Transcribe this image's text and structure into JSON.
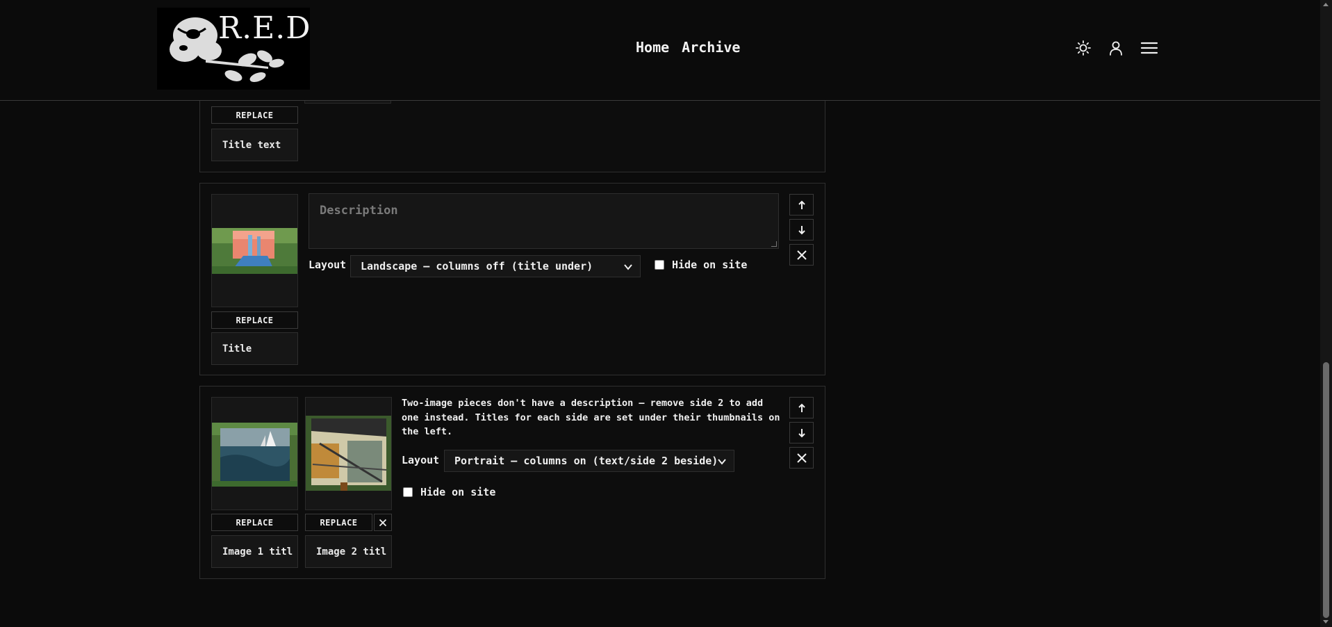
{
  "header": {
    "logo_text": "R.E.D",
    "nav": {
      "home": "Home",
      "archive": "Archive"
    },
    "icons": [
      "sun-icon",
      "user-icon",
      "menu-icon"
    ]
  },
  "card1": {
    "replace_label": "REPLACE",
    "title_value": "Title text"
  },
  "card2": {
    "description_placeholder": "Description",
    "layout_label": "Layout",
    "layout_value": "Landscape — columns off (title under)",
    "hide_label": "Hide on site",
    "replace_label": "REPLACE",
    "title_value": "Title"
  },
  "card3": {
    "note": "Two-image pieces don't have a description — remove side 2 to add one instead. Titles for each side are set under their thumbnails on the left.",
    "layout_label": "Layout",
    "layout_value": "Portrait — columns on (text/side 2 beside)",
    "hide_label": "Hide on site",
    "replace1_label": "REPLACE",
    "replace2_label": "REPLACE",
    "title1_value": "Image 1 titl",
    "title2_value": "Image 2 titl"
  },
  "colors": {
    "background": "#0b0b0b",
    "card_border": "#2f2f2f",
    "input_bg": "#161616",
    "text": "#f0f0f0",
    "placeholder": "#7a7a7a"
  }
}
